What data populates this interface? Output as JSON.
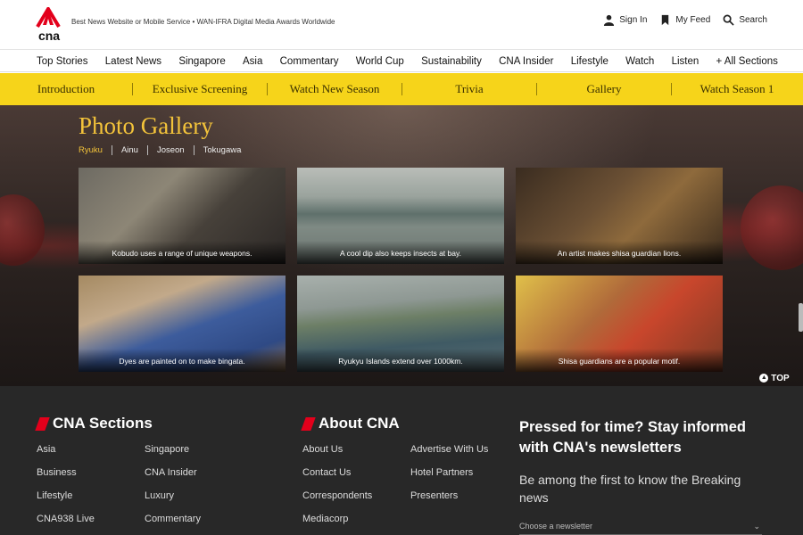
{
  "header": {
    "tagline": "Best News Website or Mobile Service • WAN-IFRA Digital Media Awards Worldwide",
    "logo_text": "cna",
    "actions": [
      {
        "label": "Sign In",
        "icon": "user-icon"
      },
      {
        "label": "My Feed",
        "icon": "bookmark-icon"
      },
      {
        "label": "Search",
        "icon": "search-icon"
      }
    ]
  },
  "main_nav": [
    "Top Stories",
    "Latest News",
    "Singapore",
    "Asia",
    "Commentary",
    "World Cup",
    "Sustainability",
    "CNA Insider",
    "Lifestyle",
    "Watch",
    "Listen",
    "+ All Sections"
  ],
  "sub_nav": [
    "Introduction",
    "Exclusive Screening",
    "Watch New Season",
    "Trivia",
    "Gallery",
    "Watch Season 1"
  ],
  "gallery": {
    "title": "Photo Gallery",
    "tabs": [
      "Ryuku",
      "Ainu",
      "Joseon",
      "Tokugawa"
    ],
    "active_tab": "Ryuku",
    "items": [
      {
        "caption": "Kobudo uses a range of unique weapons."
      },
      {
        "caption": "A cool dip also keeps insects at bay."
      },
      {
        "caption": "An artist makes shisa guardian lions."
      },
      {
        "caption": "Dyes are painted on to make bingata."
      },
      {
        "caption": "Ryukyu Islands extend over 1000km."
      },
      {
        "caption": "Shisa guardians are a popular motif."
      }
    ],
    "to_top": "TOP"
  },
  "footer": {
    "sections_title": "CNA Sections",
    "sections_col1": [
      "Asia",
      "Business",
      "Lifestyle",
      "CNA938 Live"
    ],
    "sections_col2": [
      "Singapore",
      "CNA Insider",
      "Luxury",
      "Commentary"
    ],
    "about_title": "About CNA",
    "about_col1": [
      "About Us",
      "Contact Us",
      "Correspondents",
      "Mediacorp"
    ],
    "about_col2": [
      "Advertise With Us",
      "Hotel Partners",
      "Presenters"
    ],
    "newsletter_title": "Pressed for time? Stay informed with CNA's newsletters",
    "newsletter_sub": "Be among the first to know the Breaking news",
    "newsletter_select": "Choose a newsletter"
  },
  "colors": {
    "brand_red": "#e3001b",
    "subnav_yellow": "#f6d41a",
    "gallery_gold": "#f3c33a",
    "footer_bg": "#282828"
  }
}
